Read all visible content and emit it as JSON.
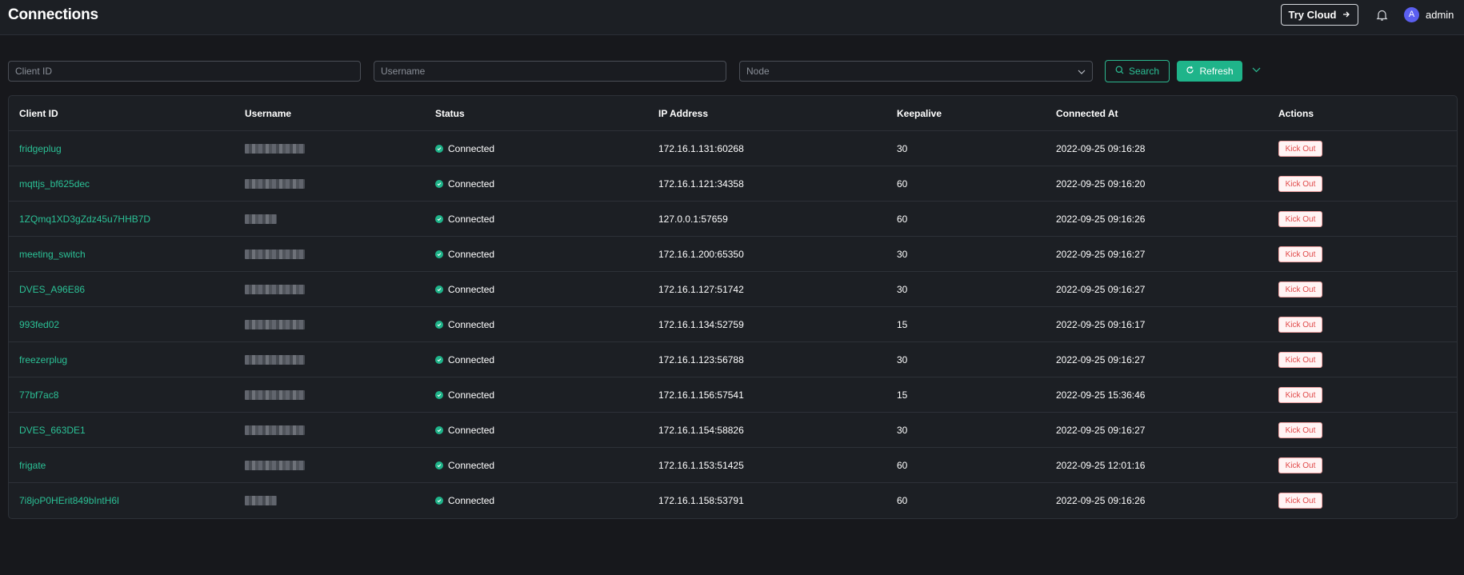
{
  "header": {
    "title": "Connections",
    "try_cloud_label": "Try Cloud",
    "user": {
      "avatar_letter": "A",
      "name": "admin"
    }
  },
  "filters": {
    "client_id_placeholder": "Client ID",
    "username_placeholder": "Username",
    "node_placeholder": "Node",
    "search_label": "Search",
    "refresh_label": "Refresh"
  },
  "table": {
    "columns": [
      "Client ID",
      "Username",
      "Status",
      "IP Address",
      "Keepalive",
      "Connected At",
      "Actions"
    ],
    "rows": [
      {
        "client_id": "fridgeplug",
        "status": "Connected",
        "ip": "172.16.1.131:60268",
        "keepalive": "30",
        "connected_at": "2022-09-25 09:16:28",
        "action": "Kick Out"
      },
      {
        "client_id": "mqttjs_bf625dec",
        "status": "Connected",
        "ip": "172.16.1.121:34358",
        "keepalive": "60",
        "connected_at": "2022-09-25 09:16:20",
        "action": "Kick Out"
      },
      {
        "client_id": "1ZQmq1XD3gZdz45u7HHB7D",
        "status": "Connected",
        "ip": "127.0.0.1:57659",
        "keepalive": "60",
        "connected_at": "2022-09-25 09:16:26",
        "action": "Kick Out"
      },
      {
        "client_id": "meeting_switch",
        "status": "Connected",
        "ip": "172.16.1.200:65350",
        "keepalive": "30",
        "connected_at": "2022-09-25 09:16:27",
        "action": "Kick Out"
      },
      {
        "client_id": "DVES_A96E86",
        "status": "Connected",
        "ip": "172.16.1.127:51742",
        "keepalive": "30",
        "connected_at": "2022-09-25 09:16:27",
        "action": "Kick Out"
      },
      {
        "client_id": "993fed02",
        "status": "Connected",
        "ip": "172.16.1.134:52759",
        "keepalive": "15",
        "connected_at": "2022-09-25 09:16:17",
        "action": "Kick Out"
      },
      {
        "client_id": "freezerplug",
        "status": "Connected",
        "ip": "172.16.1.123:56788",
        "keepalive": "30",
        "connected_at": "2022-09-25 09:16:27",
        "action": "Kick Out"
      },
      {
        "client_id": "77bf7ac8",
        "status": "Connected",
        "ip": "172.16.1.156:57541",
        "keepalive": "15",
        "connected_at": "2022-09-25 15:36:46",
        "action": "Kick Out"
      },
      {
        "client_id": "DVES_663DE1",
        "status": "Connected",
        "ip": "172.16.1.154:58826",
        "keepalive": "30",
        "connected_at": "2022-09-25 09:16:27",
        "action": "Kick Out"
      },
      {
        "client_id": "frigate",
        "status": "Connected",
        "ip": "172.16.1.153:51425",
        "keepalive": "60",
        "connected_at": "2022-09-25 12:01:16",
        "action": "Kick Out"
      },
      {
        "client_id": "7i8joP0HErit849bIntH6l",
        "status": "Connected",
        "ip": "172.16.1.158:53791",
        "keepalive": "60",
        "connected_at": "2022-09-25 09:16:26",
        "action": "Kick Out"
      }
    ]
  },
  "colors": {
    "accent": "#1fb48a",
    "link": "#2bc196",
    "danger": "#e04848"
  }
}
